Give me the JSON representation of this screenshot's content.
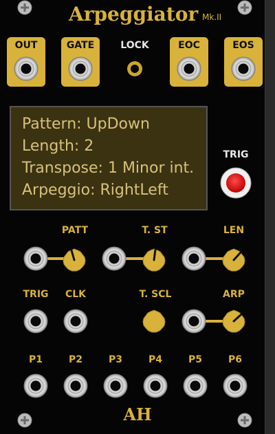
{
  "module": {
    "title": "Arpeggiator",
    "subtitle": "Mk.II",
    "logo": "AH"
  },
  "outputs": [
    {
      "label": "OUT"
    },
    {
      "label": "GATE"
    },
    {
      "label": "EOC"
    },
    {
      "label": "EOS"
    }
  ],
  "lock_label": "LOCK",
  "display": {
    "line1": "Pattern: UpDown",
    "line2": "Length: 2",
    "line3": "Transpose: 1 Minor int.",
    "line4": "Arpeggio: RightLeft"
  },
  "trig_button_label": "TRIG",
  "knob_labels": {
    "patt": "PATT",
    "tst": "T. ST",
    "len": "LEN",
    "tscl": "T. SCL",
    "arp": "ARP"
  },
  "input_labels": {
    "trig": "TRIG",
    "clk": "CLK"
  },
  "param_inputs": [
    "P1",
    "P2",
    "P3",
    "P4",
    "P5",
    "P6"
  ],
  "colors": {
    "gold": "#d8b23a",
    "panel": "#050505",
    "display_bg": "#3b3212",
    "display_text": "#d7c27a",
    "button_red": "#e01010"
  }
}
